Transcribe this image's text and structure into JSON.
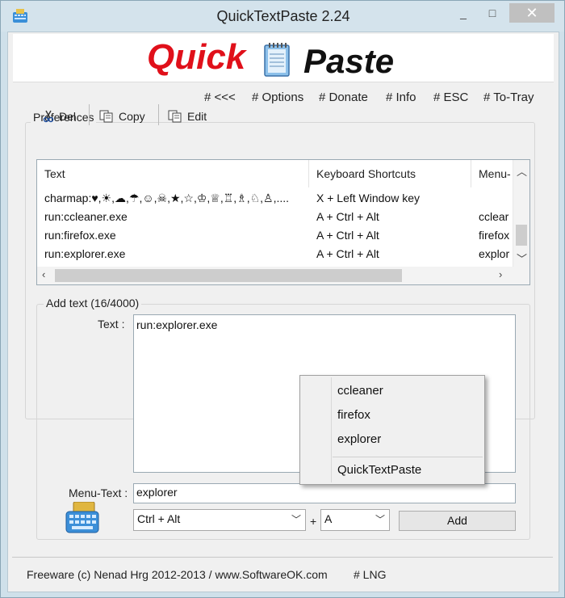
{
  "window": {
    "title": "QuickTextPaste 2.24",
    "controls": {
      "minimize": "_",
      "maximize": "□",
      "close": "✕"
    }
  },
  "banner": {
    "word1": "Quick",
    "word2": "Paste"
  },
  "top_links": [
    "# <<<",
    "# Options",
    "# Donate",
    "# Info",
    "# ESC",
    "# To-Tray"
  ],
  "preferences": {
    "label": "Preferences",
    "toolbar": {
      "del": "Del",
      "copy": "Copy",
      "edit": "Edit"
    },
    "columns": [
      "Text",
      "Keyboard Shortcuts",
      "Menu-"
    ],
    "rows": [
      {
        "text": "charmap:♥,☀,☁,☂,☺,☠,★,☆,♔,♕,♖,♗,♘,♙,....",
        "shortcut": "X + Left Window key",
        "menu": ""
      },
      {
        "text": "run:ccleaner.exe",
        "shortcut": "A + Ctrl + Alt",
        "menu": "cclear"
      },
      {
        "text": "run:firefox.exe",
        "shortcut": "A + Ctrl + Alt",
        "menu": "firefox"
      },
      {
        "text": "run:explorer.exe",
        "shortcut": "A + Ctrl + Alt",
        "menu": "explor"
      }
    ]
  },
  "add_text": {
    "label": "Add text (16/4000)",
    "text_label": "Text :",
    "text_value": "run:explorer.exe",
    "menu_text_label": "Menu-Text :",
    "menu_text_value": "explorer",
    "modifier": "Ctrl + Alt",
    "plus": "+",
    "key": "A",
    "add_button": "Add"
  },
  "popup_menu": {
    "items": [
      "ccleaner",
      "firefox",
      "explorer"
    ],
    "footer_item": "QuickTextPaste"
  },
  "footer": {
    "copyright": "Freeware (c) Nenad Hrg 2012-2013 / www.SoftwareOK.com",
    "lng": "# LNG"
  }
}
